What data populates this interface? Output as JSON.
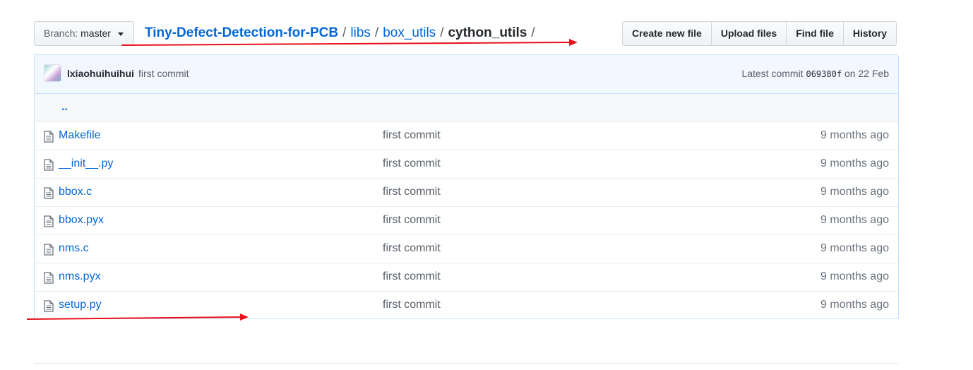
{
  "branch": {
    "prefix": "Branch:",
    "name": "master"
  },
  "breadcrumb": {
    "repo": "Tiny-Defect-Detection-for-PCB",
    "sep": "/",
    "parts": [
      "libs",
      "box_utils"
    ],
    "current": "cython_utils",
    "trailing": "/"
  },
  "actions": {
    "create": "Create new file",
    "upload": "Upload files",
    "find": "Find file",
    "history": "History"
  },
  "commit": {
    "author": "lxiaohuihuihui",
    "message": "first commit",
    "latest_label": "Latest commit",
    "sha": "069380f",
    "date_label": "on 22 Feb"
  },
  "parent_link": "..",
  "files": [
    {
      "name": "Makefile",
      "message": "first commit",
      "age": "9 months ago"
    },
    {
      "name": "__init__.py",
      "message": "first commit",
      "age": "9 months ago"
    },
    {
      "name": "bbox.c",
      "message": "first commit",
      "age": "9 months ago"
    },
    {
      "name": "bbox.pyx",
      "message": "first commit",
      "age": "9 months ago"
    },
    {
      "name": "nms.c",
      "message": "first commit",
      "age": "9 months ago"
    },
    {
      "name": "nms.pyx",
      "message": "first commit",
      "age": "9 months ago"
    },
    {
      "name": "setup.py",
      "message": "first commit",
      "age": "9 months ago"
    }
  ],
  "icons": {
    "file": "file-icon",
    "caret": "caret-down-icon"
  },
  "colors": {
    "link": "#0366d6",
    "annotation": "#e8101a"
  }
}
